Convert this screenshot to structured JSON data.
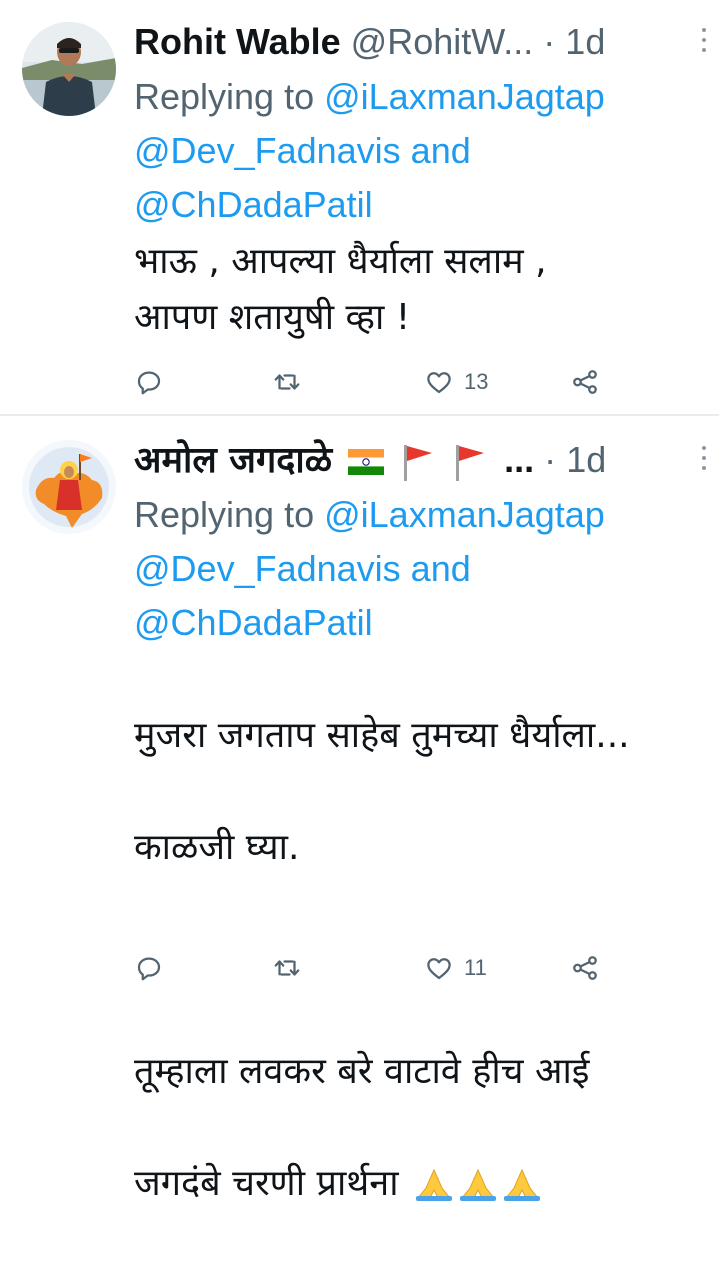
{
  "tweets": [
    {
      "name": "Rohit Wable",
      "handle": "@RohitW...",
      "dot": "·",
      "time": "1d",
      "replying_prefix": "Replying to ",
      "mention1": "@iLaxmanJagtap",
      "mention2": "@Dev_Fadnavis",
      "and_text": " and",
      "mention3": "@ChDadaPatil",
      "body": "भाऊ , आपल्या धैर्याला सलाम ,\nआपण शतायुषी व्हा !",
      "likes": "13"
    },
    {
      "name": "अमोल जगदाळे",
      "ellipsis": "...",
      "dot": "·",
      "time": "1d",
      "replying_prefix": "Replying to ",
      "mention1": "@iLaxmanJagtap",
      "mention2": "@Dev_Fadnavis",
      "and_text": " and",
      "mention3": "@ChDadaPatil",
      "body_line1": "मुजरा जगताप साहेब तुमच्या धैर्याला...",
      "body_line2": "काळजी घ्या.",
      "body_line3": "तूम्हाला लवकर बरे वाटावे हीच आई",
      "body_line4": "जगदंबे चरणी प्रार्थना",
      "likes": "11"
    }
  ],
  "icons": {
    "reply": "reply-icon",
    "retweet": "retweet-icon",
    "like": "heart-icon",
    "share": "share-icon",
    "more": "more-vertical-icon",
    "flag_india": "india-flag-icon",
    "flag_saffron": "saffron-flag-icon",
    "pray": "folded-hands-icon"
  },
  "colors": {
    "link": "#1d9bf0",
    "secondary_text": "#536471",
    "primary_text": "#0f1419",
    "saffron": "#ff9933"
  }
}
